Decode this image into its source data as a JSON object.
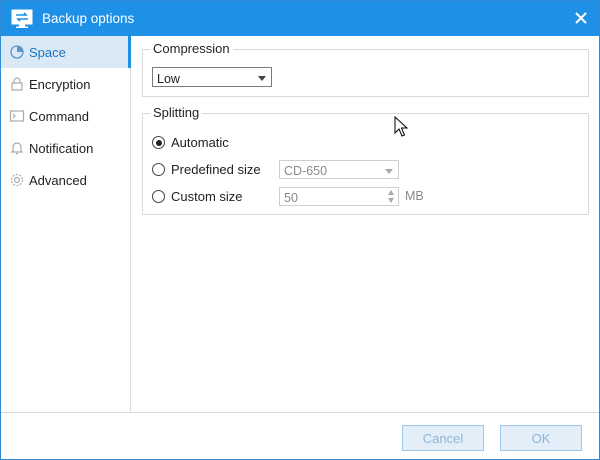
{
  "window": {
    "title": "Backup options"
  },
  "sidebar": {
    "items": [
      {
        "label": "Space",
        "icon": "pie-chart-icon",
        "active": true
      },
      {
        "label": "Encryption",
        "icon": "lock-icon",
        "active": false
      },
      {
        "label": "Command",
        "icon": "terminal-icon",
        "active": false
      },
      {
        "label": "Notification",
        "icon": "bell-icon",
        "active": false
      },
      {
        "label": "Advanced",
        "icon": "gear-icon",
        "active": false
      }
    ]
  },
  "compression": {
    "legend": "Compression",
    "selected": "Low"
  },
  "splitting": {
    "legend": "Splitting",
    "options": [
      {
        "label": "Automatic",
        "checked": true
      },
      {
        "label": "Predefined size",
        "checked": false
      },
      {
        "label": "Custom size",
        "checked": false
      }
    ],
    "predefined_value": "CD-650",
    "custom_value": "50",
    "custom_unit": "MB"
  },
  "footer": {
    "cancel_label": "Cancel",
    "ok_label": "OK"
  },
  "colors": {
    "titlebar": "#1e90e6",
    "active_nav_bg": "#dbe9f7",
    "active_nav_text": "#1a74c4",
    "disabled_button_text": "#8fb6d8"
  }
}
